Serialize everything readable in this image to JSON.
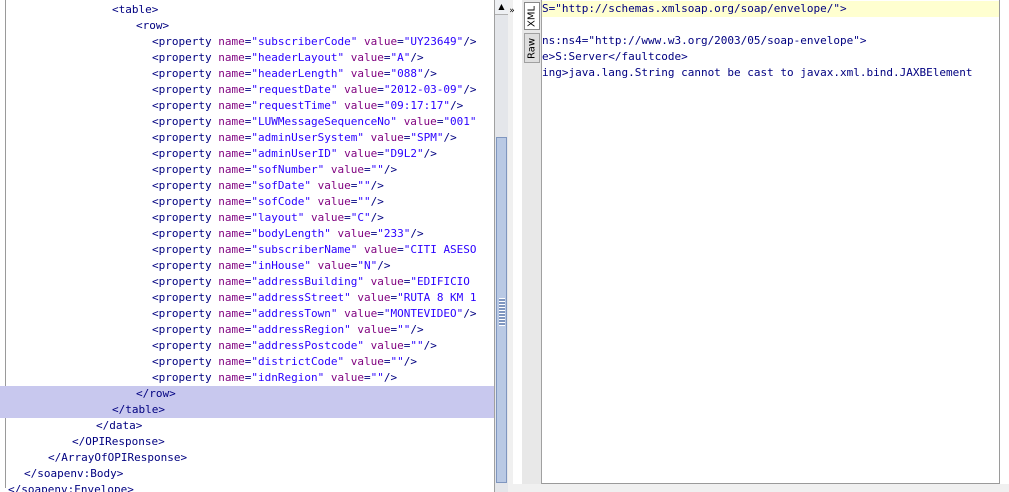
{
  "left_editor": {
    "lines": [
      {
        "indent": 13,
        "text": "<table>"
      },
      {
        "indent": 16,
        "text": "<row>"
      },
      {
        "indent": 18,
        "text": "<property ",
        "attr": "name",
        "val": "\"subscriberCode\"",
        "attr2": "value",
        "val2": "\"UY23649\"",
        "end": "/>"
      },
      {
        "indent": 18,
        "text": "<property ",
        "attr": "name",
        "val": "\"headerLayout\"",
        "attr2": "value",
        "val2": "\"A\"",
        "end": "/>"
      },
      {
        "indent": 18,
        "text": "<property ",
        "attr": "name",
        "val": "\"headerLength\"",
        "attr2": "value",
        "val2": "\"088\"",
        "end": "/>"
      },
      {
        "indent": 18,
        "text": "<property ",
        "attr": "name",
        "val": "\"requestDate\"",
        "attr2": "value",
        "val2": "\"2012-03-09\"",
        "end": "/>"
      },
      {
        "indent": 18,
        "text": "<property ",
        "attr": "name",
        "val": "\"requestTime\"",
        "attr2": "value",
        "val2": "\"09:17:17\"",
        "end": "/>"
      },
      {
        "indent": 18,
        "text": "<property ",
        "attr": "name",
        "val": "\"LUWMessageSequenceNo\"",
        "attr2": "value",
        "val2": "\"001\"",
        "end": ""
      },
      {
        "indent": 18,
        "text": "<property ",
        "attr": "name",
        "val": "\"adminUserSystem\"",
        "attr2": "value",
        "val2": "\"SPM\"",
        "end": "/>"
      },
      {
        "indent": 18,
        "text": "<property ",
        "attr": "name",
        "val": "\"adminUserID\"",
        "attr2": "value",
        "val2": "\"D9L2\"",
        "end": "/>"
      },
      {
        "indent": 18,
        "text": "<property ",
        "attr": "name",
        "val": "\"sofNumber\"",
        "attr2": "value",
        "val2": "\"\"",
        "end": "/>"
      },
      {
        "indent": 18,
        "text": "<property ",
        "attr": "name",
        "val": "\"sofDate\"",
        "attr2": "value",
        "val2": "\"\"",
        "end": "/>"
      },
      {
        "indent": 18,
        "text": "<property ",
        "attr": "name",
        "val": "\"sofCode\"",
        "attr2": "value",
        "val2": "\"\"",
        "end": "/>"
      },
      {
        "indent": 18,
        "text": "<property ",
        "attr": "name",
        "val": "\"layout\"",
        "attr2": "value",
        "val2": "\"C\"",
        "end": "/>"
      },
      {
        "indent": 18,
        "text": "<property ",
        "attr": "name",
        "val": "\"bodyLength\"",
        "attr2": "value",
        "val2": "\"233\"",
        "end": "/>"
      },
      {
        "indent": 18,
        "text": "<property ",
        "attr": "name",
        "val": "\"subscriberName\"",
        "attr2": "value",
        "val2": "\"CITI ASESO",
        "end": ""
      },
      {
        "indent": 18,
        "text": "<property ",
        "attr": "name",
        "val": "\"inHouse\"",
        "attr2": "value",
        "val2": "\"N\"",
        "end": "/>"
      },
      {
        "indent": 18,
        "text": "<property ",
        "attr": "name",
        "val": "\"addressBuilding\"",
        "attr2": "value",
        "val2": "\"EDIFICIO ",
        "end": ""
      },
      {
        "indent": 18,
        "text": "<property ",
        "attr": "name",
        "val": "\"addressStreet\"",
        "attr2": "value",
        "val2": "\"RUTA 8 KM 1",
        "end": ""
      },
      {
        "indent": 18,
        "text": "<property ",
        "attr": "name",
        "val": "\"addressTown\"",
        "attr2": "value",
        "val2": "\"MONTEVIDEO\"",
        "end": "/>"
      },
      {
        "indent": 18,
        "text": "<property ",
        "attr": "name",
        "val": "\"addressRegion\"",
        "attr2": "value",
        "val2": "\"\"",
        "end": "/>"
      },
      {
        "indent": 18,
        "text": "<property ",
        "attr": "name",
        "val": "\"addressPostcode\"",
        "attr2": "value",
        "val2": "\"\"",
        "end": "/>"
      },
      {
        "indent": 18,
        "text": "<property ",
        "attr": "name",
        "val": "\"districtCode\"",
        "attr2": "value",
        "val2": "\"\"",
        "end": "/>"
      },
      {
        "indent": 18,
        "text": "<property ",
        "attr": "name",
        "val": "\"idnRegion\"",
        "attr2": "value",
        "val2": "\"\"",
        "end": "/>"
      },
      {
        "indent": 16,
        "text": "</row>",
        "sel": true
      },
      {
        "indent": 13,
        "text": "</table>",
        "sel": true
      },
      {
        "indent": 11,
        "text": "</data>"
      },
      {
        "indent": 8,
        "text": "</OPIResponse>"
      },
      {
        "indent": 5,
        "text": "</ArrayOfOPIResponse>"
      },
      {
        "indent": 2,
        "text": "</soapenv:Body>"
      },
      {
        "indent": 0,
        "text": "</soapenv:Envelope>"
      }
    ]
  },
  "scrollbar": {
    "arrow_glyph": "▲"
  },
  "splitter": {
    "glyph": "»"
  },
  "tabs": {
    "xml": "XML",
    "raw": "Raw"
  },
  "right_editor": {
    "lines": [
      {
        "text": "S=\"http://schemas.xmlsoap.org/soap/envelope/\">",
        "hl": true
      },
      {
        "text": ""
      },
      {
        "text": "ns:ns4=\"http://www.w3.org/2003/05/soap-envelope\">"
      },
      {
        "text": "e>S:Server</faultcode>"
      },
      {
        "text": "ing>java.lang.String cannot be cast to javax.xml.bind.JAXBElement"
      }
    ]
  }
}
